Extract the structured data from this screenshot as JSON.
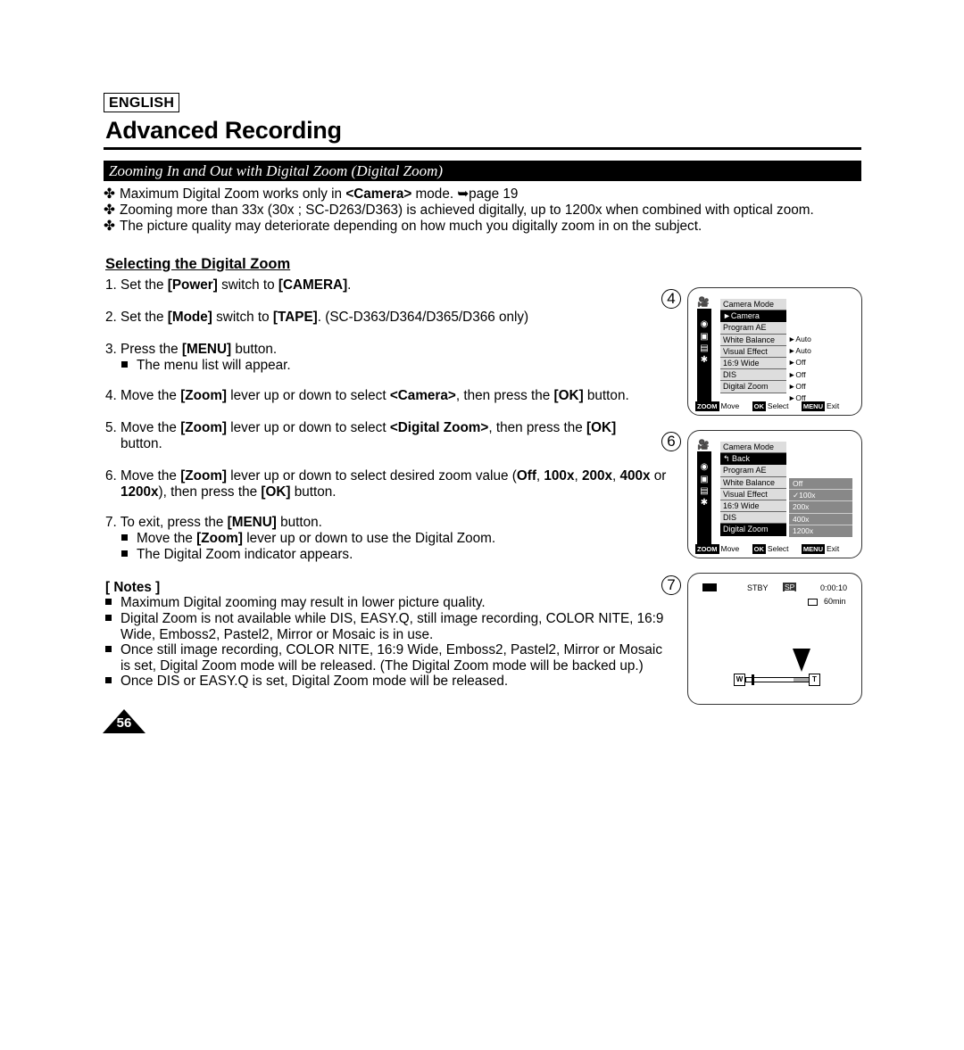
{
  "header": {
    "language": "ENGLISH",
    "title": "Advanced Recording",
    "section_banner": "Zooming In and Out with Digital Zoom (Digital Zoom)"
  },
  "intro_bullets": [
    {
      "mark": "✤",
      "pre": "Maximum Digital Zoom works only in ",
      "bold": "<Camera>",
      "post": " mode. ➥page 19"
    },
    {
      "mark": "✤",
      "text": "Zooming more than 33x (30x ; SC-D263/D363) is achieved digitally, up to 1200x when combined with optical zoom."
    },
    {
      "mark": "✤",
      "text": "The picture quality may deteriorate depending on how much you digitally zoom in on the subject."
    }
  ],
  "subsection": "Selecting the Digital Zoom",
  "steps": {
    "s1": {
      "a": "1. Set the ",
      "b": "[Power]",
      "c": " switch to ",
      "d": "[CAMERA]",
      "e": "."
    },
    "s2": {
      "a": "2. Set the ",
      "b": "[Mode]",
      "c": " switch to ",
      "d": "[TAPE]",
      "e": ". (SC-D363/D364/D365/D366 only)"
    },
    "s3": {
      "a": "3. Press the ",
      "b": "[MENU]",
      "c": " button.",
      "sub": "The menu list will appear."
    },
    "s4": {
      "a": "4. Move the ",
      "b": "[Zoom]",
      "c": " lever up or down to select ",
      "d": "<Camera>",
      "e": ", then press the ",
      "f": "[OK]",
      "g": " button."
    },
    "s5": {
      "a": "5. Move the ",
      "b": "[Zoom]",
      "c": " lever up or down to select ",
      "d": "<Digital Zoom>",
      "e": ", then press the ",
      "f": "[OK]",
      "line2": "button."
    },
    "s6": {
      "a": "6. Move the ",
      "b": "[Zoom]",
      "c": " lever up or down to select desired zoom value (",
      "v1": "Off",
      "sep1": ", ",
      "v2": "100x",
      "sep2": ", ",
      "v3": "200x",
      "sep3": ", ",
      "v4": "400x",
      "or": " or",
      "v5": "1200x",
      "d": "), then press the ",
      "f": "[OK]",
      "g": " button."
    },
    "s7": {
      "a": "7. To exit, press the ",
      "b": "[MENU]",
      "c": " button.",
      "sub1a": "Move the ",
      "sub1b": "[Zoom]",
      "sub1c": " lever up or down to use the Digital Zoom.",
      "sub2": "The Digital Zoom indicator appears."
    }
  },
  "notes": {
    "heading": "[ Notes ]",
    "items": [
      {
        "l1": "Maximum Digital zooming may result in lower picture quality."
      },
      {
        "l1": "Digital Zoom is not available while DIS, EASY.Q, still image recording, COLOR NITE, 16:9",
        "l2": "Wide, Emboss2, Pastel2, Mirror or Mosaic is in use."
      },
      {
        "l1": "Once still image recording, COLOR NITE, 16:9 Wide, Emboss2, Pastel2, Mirror or Mosaic",
        "l2": "is set, Digital Zoom mode will be released. (The Digital Zoom mode will be backed up.)"
      },
      {
        "l1": "Once DIS or EASY.Q is set, Digital Zoom mode will be released."
      }
    ]
  },
  "screens": {
    "s4": {
      "label": "4",
      "menu": [
        "Camera Mode",
        "►Camera",
        "Program AE",
        "White Balance",
        "Visual Effect",
        "16:9 Wide",
        "DIS",
        "Digital Zoom"
      ],
      "values": [
        "►Auto",
        "►Auto",
        "►Off",
        "►Off",
        "►Off",
        "►Off"
      ],
      "footer": {
        "k1": "ZOOM",
        "t1": "Move",
        "k2": "OK",
        "t2": "Select",
        "k3": "MENU",
        "t3": "Exit"
      }
    },
    "s6": {
      "label": "6",
      "menu": [
        "Camera Mode",
        "↰ Back",
        "Program AE",
        "White Balance",
        "Visual Effect",
        "16:9 Wide",
        "DIS",
        "Digital Zoom"
      ],
      "options": [
        "Off",
        "✓100x",
        "200x",
        "400x",
        "1200x"
      ],
      "footer": {
        "k1": "ZOOM",
        "t1": "Move",
        "k2": "OK",
        "t2": "Select",
        "k3": "MENU",
        "t3": "Exit"
      }
    },
    "s7": {
      "label": "7",
      "status": "STBY",
      "mode": "SP",
      "counter": "0:00:10",
      "remaining": "60min",
      "zoom_wide": "W",
      "zoom_tele": "T",
      "optical_fraction": 0.1,
      "digital_position": 0.87
    }
  },
  "page_number": "56"
}
